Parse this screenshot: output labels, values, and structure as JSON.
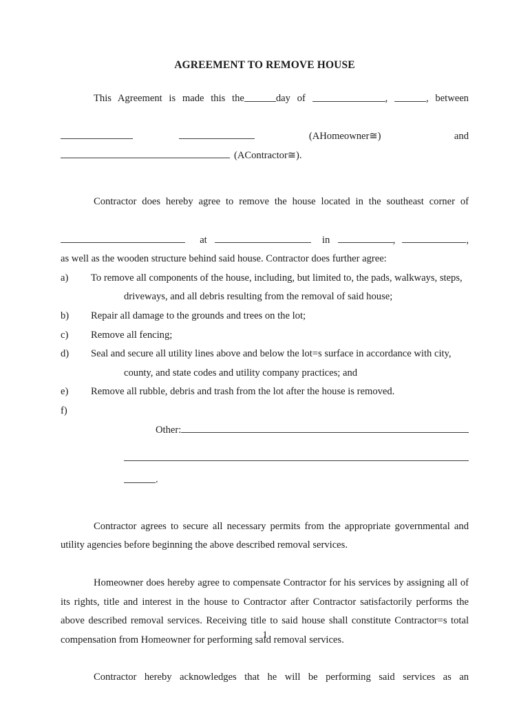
{
  "document": {
    "title": "AGREEMENT TO REMOVE HOUSE",
    "page_number": "1"
  },
  "intro": {
    "line1_text_a": "This Agreement is made this the",
    "line1_text_b": "day of",
    "line1_text_c": ",",
    "line1_text_d": ",",
    "line1_text_e": "between",
    "line2_homeowner_label": "(AHomeowner≅)",
    "line2_and": "and",
    "line3_contractor_label": "(AContractor≅)."
  },
  "scope": {
    "lead_in": "Contractor does hereby agree to remove the house located in the southeast corner of",
    "at_label": "at",
    "in_label": "in",
    "comma_1": ",",
    "comma_2": ",",
    "continuation": "as well as the wooden structure behind said house.  Contractor does further agree:"
  },
  "obligations": [
    {
      "marker": "a)",
      "text": "To remove all components of the house, including, but limited to, the pads, walkways, steps, driveways, and all debris resulting from the removal of said house;"
    },
    {
      "marker": "b)",
      "text": "Repair all damage to the grounds and trees on the lot;"
    },
    {
      "marker": "c)",
      "text": "Remove all fencing;"
    },
    {
      "marker": "d)",
      "text": "Seal and secure all utility lines above and below the lot=s surface in accordance with city, county, and state codes and utility company practices; and"
    },
    {
      "marker": "e)",
      "text": "Remove all rubble, debris and trash from the lot after the house is removed."
    },
    {
      "marker": "f)",
      "text": ""
    }
  ],
  "other_block": {
    "label": "Other:",
    "terminator": "."
  },
  "permits_paragraph": "Contractor agrees to secure all necessary permits from the appropriate governmental and utility agencies before beginning the above described removal services.",
  "compensation_paragraph": "Homeowner does hereby agree to compensate Contractor for his services by assigning all of its rights, title and interest in the house to Contractor after Contractor satisfactorily performs the above described removal services.  Receiving title to said house shall constitute Contractor=s total compensation from Homeowner for performing said removal services.",
  "acknowledgement_paragraph": "Contractor hereby acknowledges that he will be performing said services as an"
}
